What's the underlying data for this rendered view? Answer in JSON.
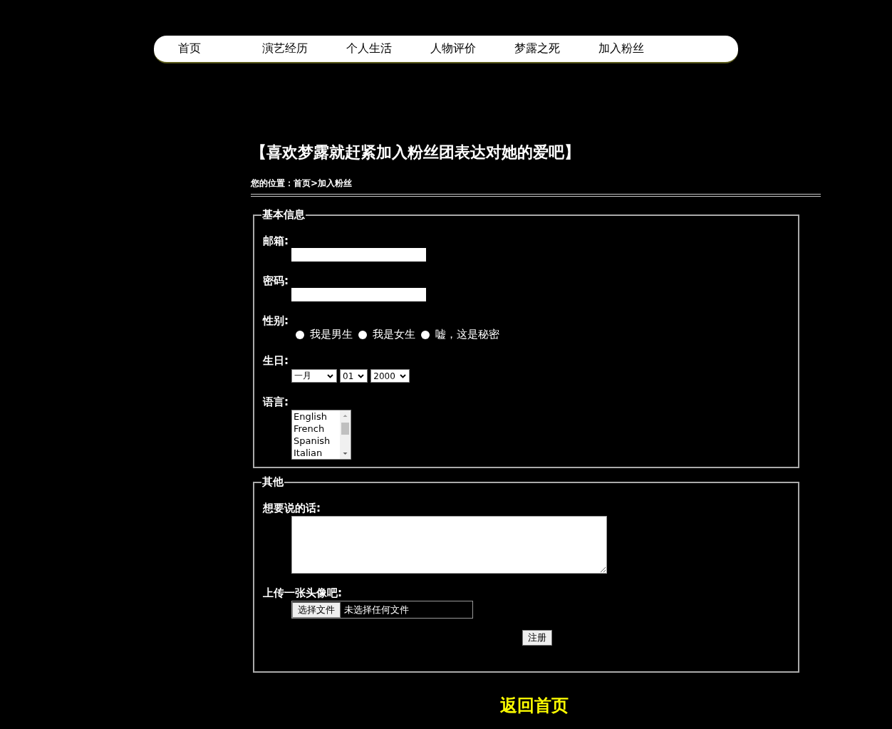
{
  "nav": [
    {
      "label": "首页"
    },
    {
      "label": "演艺经历"
    },
    {
      "label": "个人生活"
    },
    {
      "label": "人物评价"
    },
    {
      "label": "梦露之死"
    },
    {
      "label": "加入粉丝"
    }
  ],
  "title": "【喜欢梦露就赶紧加入粉丝团表达对她的爱吧】",
  "breadcrumb": "您的位置：首页>加入粉丝",
  "sections": [
    {
      "legend": "基本信息",
      "fields": [
        {
          "kind": "text",
          "label": "邮箱:"
        },
        {
          "kind": "password",
          "label": "密码:"
        },
        {
          "kind": "radio",
          "label": "性别:",
          "options": [
            {
              "label": "我是男生",
              "selected": false
            },
            {
              "label": "我是女生",
              "selected": false
            },
            {
              "label": "嘘，这是秘密",
              "selected": false
            }
          ]
        },
        {
          "kind": "dropdowns",
          "label": "生日:",
          "values": [
            "一月",
            "01",
            "2000"
          ]
        },
        {
          "kind": "listbox",
          "label": "语言:",
          "options": [
            "English",
            "French",
            "Spanish",
            "Italian"
          ]
        }
      ]
    },
    {
      "legend": "其他",
      "fields": [
        {
          "kind": "textarea",
          "label": "想要说的话:"
        },
        {
          "kind": "file",
          "label": "上传一张头像吧:",
          "button": "选择文件",
          "status": "未选择任何文件"
        },
        {
          "kind": "submit",
          "button": "注册"
        }
      ]
    }
  ],
  "back_link": "返回首页"
}
